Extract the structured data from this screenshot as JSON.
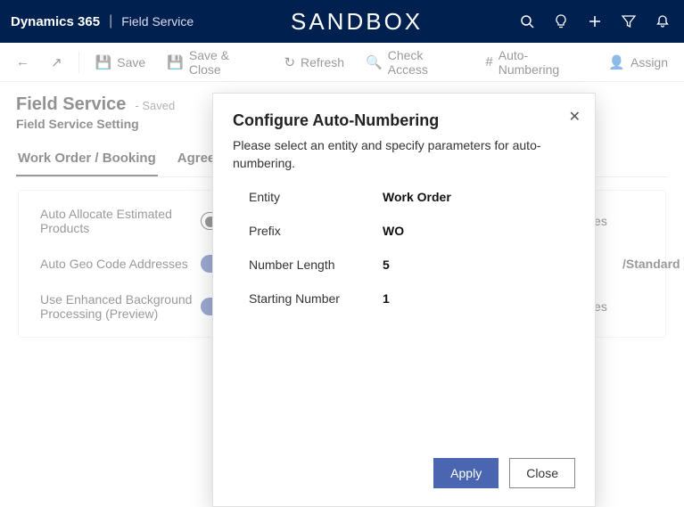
{
  "top": {
    "brand": "Dynamics 365",
    "module": "Field Service",
    "env": "SANDBOX"
  },
  "cmd": {
    "save": "Save",
    "saveClose": "Save & Close",
    "refresh": "Refresh",
    "checkAccess": "Check Access",
    "autoNumbering": "Auto-Numbering",
    "assign": "Assign"
  },
  "page": {
    "title": "Field Service",
    "status": "- Saved",
    "subtitle": "Field Service Setting",
    "tabs": [
      "Work Order / Booking",
      "Agreement"
    ]
  },
  "form": {
    "rows": [
      {
        "label": "Auto Allocate Estimated Products",
        "toggle": "off",
        "rightValue": "Yes"
      },
      {
        "label": "Auto Geo Code Addresses",
        "toggle": "on",
        "rightValue": "/Standard"
      },
      {
        "label": "Use Enhanced Background Processing (Preview)",
        "toggle": "on",
        "rightValue": "Yes"
      }
    ]
  },
  "modal": {
    "title": "Configure Auto-Numbering",
    "desc": "Please select an entity and specify parameters for auto-numbering.",
    "fields": {
      "entityLabel": "Entity",
      "entityValue": "Work Order",
      "prefixLabel": "Prefix",
      "prefixValue": "WO",
      "lengthLabel": "Number Length",
      "lengthValue": "5",
      "startLabel": "Starting Number",
      "startValue": "1"
    },
    "apply": "Apply",
    "close": "Close"
  }
}
